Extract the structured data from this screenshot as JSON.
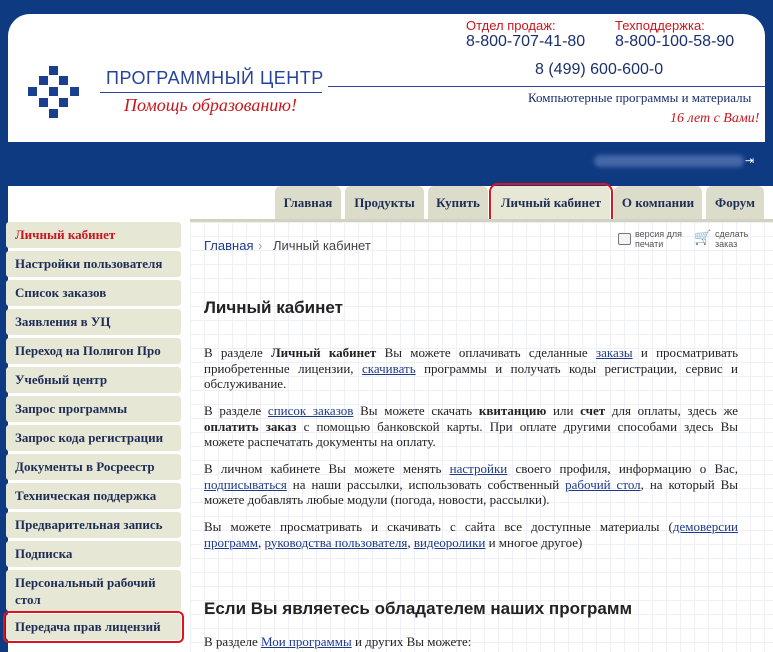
{
  "header": {
    "logo_title": "ПРОГРАММНЫЙ ЦЕНТР",
    "logo_subtitle": "Помощь образованию!",
    "sales_label": "Отдел продаж:",
    "sales_phone": "8-800-707-41-80",
    "support_label": "Техподдержка:",
    "support_phone": "8-800-100-58-90",
    "main_phone": "8 (499) 600-600-0",
    "tagline": "Компьютерные программы и материалы",
    "years": "16 лет с Вами!",
    "colors": {
      "brand_blue": "#0e3a82",
      "accent_red": "#c8161d"
    }
  },
  "userbar": {
    "logout_icon": "logout-icon"
  },
  "tabs": [
    {
      "label": "Главная"
    },
    {
      "label": "Продукты"
    },
    {
      "label": "Купить"
    },
    {
      "label": "Личный кабинет"
    },
    {
      "label": "О компании"
    },
    {
      "label": "Форум"
    }
  ],
  "sidebar": {
    "items": [
      {
        "label": "Личный кабинет"
      },
      {
        "label": "Настройки пользователя"
      },
      {
        "label": "Список заказов"
      },
      {
        "label": "Заявления в УЦ"
      },
      {
        "label": "Переход на Полигон Про"
      },
      {
        "label": "Учебный центр"
      },
      {
        "label": "Запрос программы"
      },
      {
        "label": "Запрос кода регистрации"
      },
      {
        "label": "Документы в Росреестр"
      },
      {
        "label": "Техническая поддержка"
      },
      {
        "label": "Предварительная запись"
      },
      {
        "label": "Подписка"
      },
      {
        "label": "Персональный рабочий стол"
      },
      {
        "label": "Передача прав лицензий"
      }
    ]
  },
  "breadcrumb": {
    "home": "Главная",
    "separator": "›",
    "current": "Личный кабинет"
  },
  "tools": {
    "print": "версия для печати",
    "order": "сделать заказ"
  },
  "main": {
    "title": "Личный кабинет",
    "p1": {
      "t1": "В разделе ",
      "b1": "Личный кабинет",
      "t2": " Вы можете оплачивать сделанные ",
      "l1": "заказы",
      "t3": " и просматривать приобретенные лицензии, ",
      "l2": "скачивать",
      "t4": " программы и получать коды регистрации, сервис и обслуживание."
    },
    "p2": {
      "t1": "В разделе ",
      "l1": "список заказов",
      "t2": " Вы можете скачать ",
      "b1": "квитанцию",
      "t3": " или ",
      "b2": "счет",
      "t4": " для оплаты, здесь же ",
      "b3": "оплатить заказ",
      "t5": " с помощью банковской карты. При оплате другими способами здесь Вы можете распечатать документы на оплату."
    },
    "p3": {
      "t1": "В личном кабинете Вы можете менять ",
      "l1": "настройки",
      "t2": " своего профиля, информацию о Вас, ",
      "l2": "подписываться",
      "t3": " на наши рассылки, использовать собственный ",
      "l3": "рабочий стол",
      "t4": ", на который Вы можете добавлять любые модули (погода, новости, рассылки)."
    },
    "p4": {
      "t1": "Вы можете просматривать и скачивать с сайта все доступные материалы (",
      "l1": "демоверсии программ",
      "t2": ", ",
      "l2": "руководства пользователя",
      "t3": ", ",
      "l3": "видеоролики",
      "t4": " и многое другое)"
    },
    "subtitle": "Если Вы являетесь обладателем наших программ",
    "p5": {
      "t1": "В разделе ",
      "l1": "Мои программы",
      "t2": " и других Вы можете:"
    }
  }
}
